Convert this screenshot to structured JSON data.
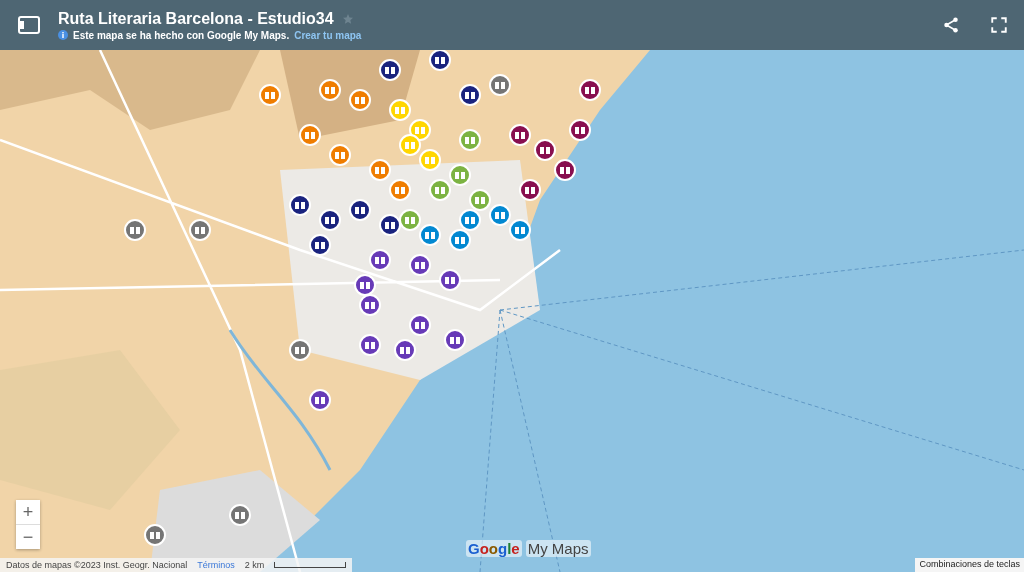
{
  "header": {
    "title": "Ruta Literaria Barcelona - Estudio34",
    "starred": false,
    "info": "Este mapa se ha hecho con Google My Maps.",
    "link": "Crear tu mapa"
  },
  "zoom": [
    "+",
    "−"
  ],
  "logo": {
    "brand": "Google",
    "product": "My Maps"
  },
  "footer": {
    "data": "Datos de mapas ©2023 Inst. Geogr. Nacional",
    "terms": "Términos",
    "scale": "2 km",
    "shortcuts": "Combinaciones de teclas"
  }
}
